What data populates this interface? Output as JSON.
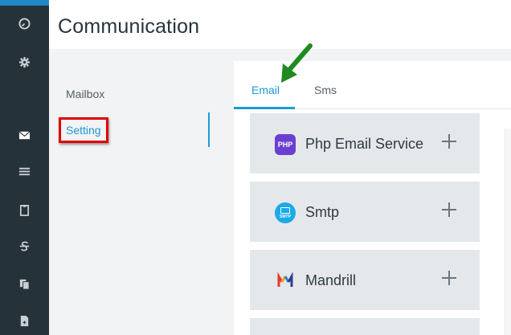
{
  "app": {
    "title": "Communication",
    "accent_color": "#1e9ad6"
  },
  "rail": {
    "icons": [
      {
        "name": "dashboard-icon"
      },
      {
        "name": "gear-icon"
      },
      {
        "name": "mail-icon"
      },
      {
        "name": "list-icon"
      },
      {
        "name": "clipboard-icon"
      },
      {
        "name": "strikethrough-icon"
      },
      {
        "name": "copy-icon"
      },
      {
        "name": "document-icon"
      }
    ]
  },
  "settings_menu": {
    "items": [
      {
        "label": "Mailbox"
      },
      {
        "label": "Setting",
        "active": true
      }
    ]
  },
  "tabs": [
    {
      "label": "Email",
      "active": true
    },
    {
      "label": "Sms"
    }
  ],
  "services": [
    {
      "label": "Php Email Service",
      "icon": "php-icon",
      "icon_text": "PHP"
    },
    {
      "label": "Smtp",
      "icon": "smtp-icon",
      "icon_text": "SMTP"
    },
    {
      "label": "Mandrill",
      "icon": "mandrill-icon"
    }
  ]
}
